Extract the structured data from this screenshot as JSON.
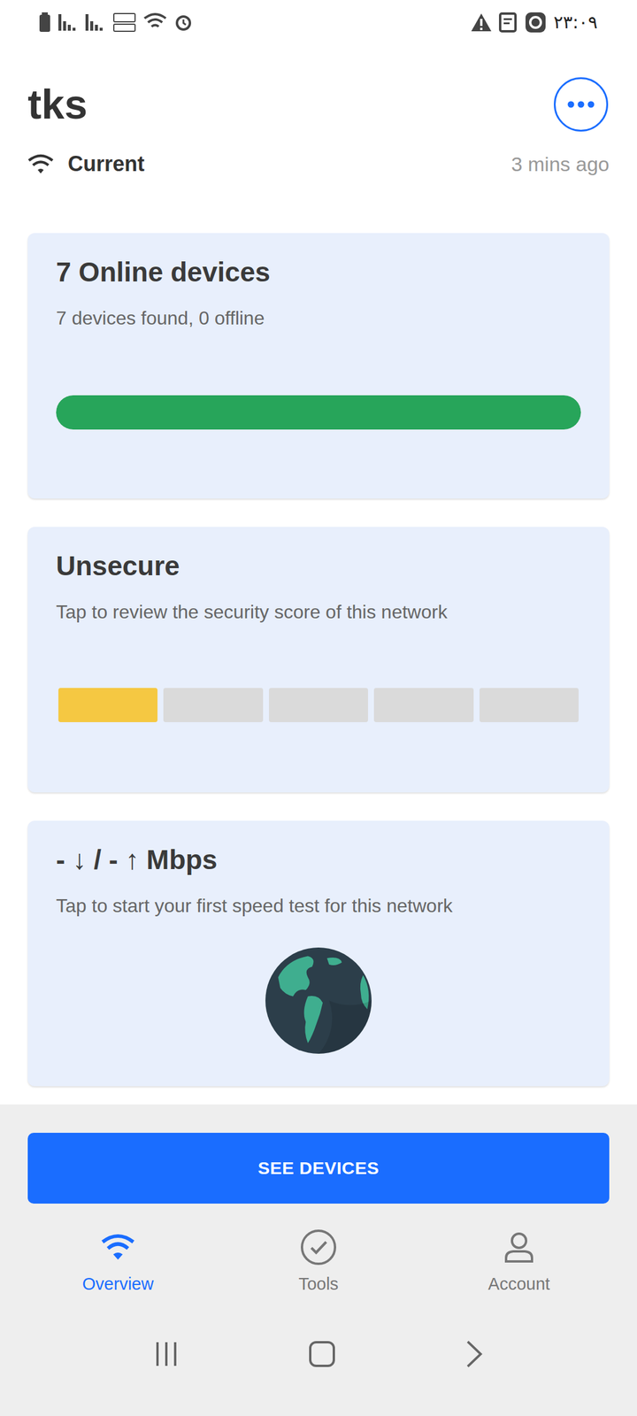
{
  "status_bar": {
    "time": "۲۳:۰۹"
  },
  "network": {
    "name": "tks",
    "connection": "Current",
    "updated": "3 mins ago"
  },
  "cards": [
    {
      "kind": "progress",
      "title": "7 Online devices",
      "subtitle": "7 devices found, 0 offline",
      "level": 1
    },
    {
      "kind": "segments",
      "title": "Unsecure",
      "subtitle": "Tap to review the security score of this network",
      "level": 0.2
    },
    {
      "kind": "speed",
      "title": "- ↓ / - ↑ Mbps",
      "subtitle": "Tap to start your first speed test for this network"
    }
  ],
  "primary_button": {
    "label": "SEE DEVICES"
  },
  "nav": [
    {
      "label": "Overview",
      "selected": true
    },
    {
      "label": "Tools",
      "selected": false
    },
    {
      "label": "Account",
      "selected": false
    }
  ]
}
